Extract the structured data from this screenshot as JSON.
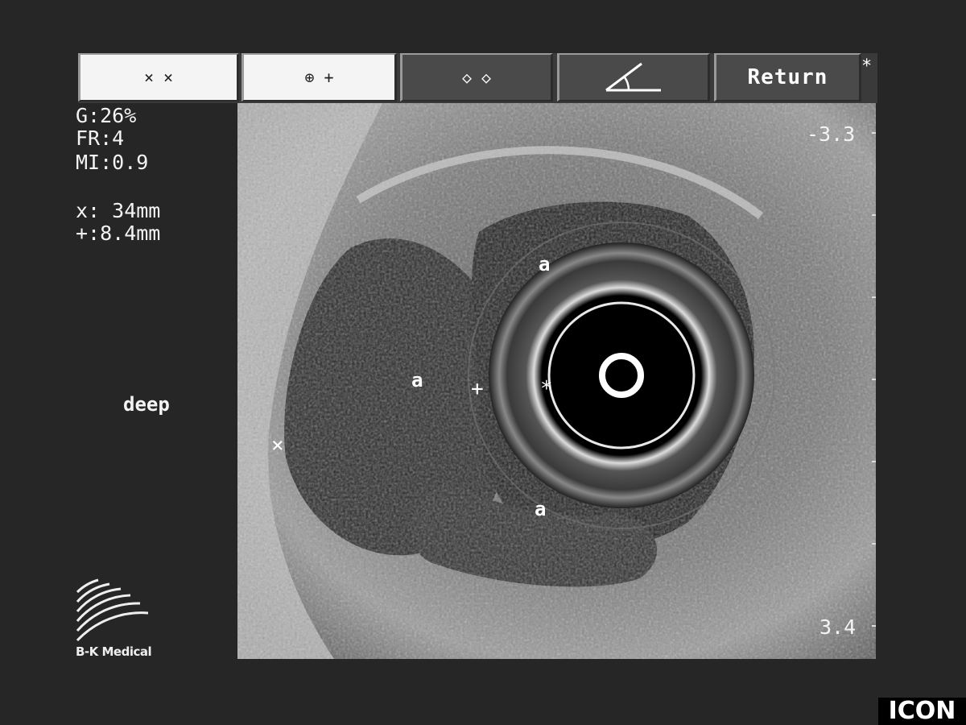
{
  "toolbar": {
    "buttons": [
      {
        "label": "× ×"
      },
      {
        "label": "⊕ +"
      },
      {
        "label": "◇ ◇"
      },
      {
        "label": ""
      },
      {
        "label": "Return"
      }
    ],
    "star": "*"
  },
  "readout": {
    "gain": "G:26%",
    "frame_rate": "FR:4",
    "mi": "MI:0.9",
    "dist_x": "x: 34mm",
    "dist_plus": "+:8.4mm"
  },
  "depth_mode": "deep",
  "scale": {
    "top": "-3.3",
    "bottom": "3.4"
  },
  "annotations": {
    "label_a": "a",
    "cursor_x": "×",
    "cursor_plus": "+",
    "cursor_star": "*"
  },
  "branding": {
    "logo": "B-K Medical",
    "badge": "ICON"
  },
  "colors": {
    "background": "#262626",
    "toolbar_light": "#f4f4f4",
    "toolbar_dark": "#4a4a4a"
  }
}
